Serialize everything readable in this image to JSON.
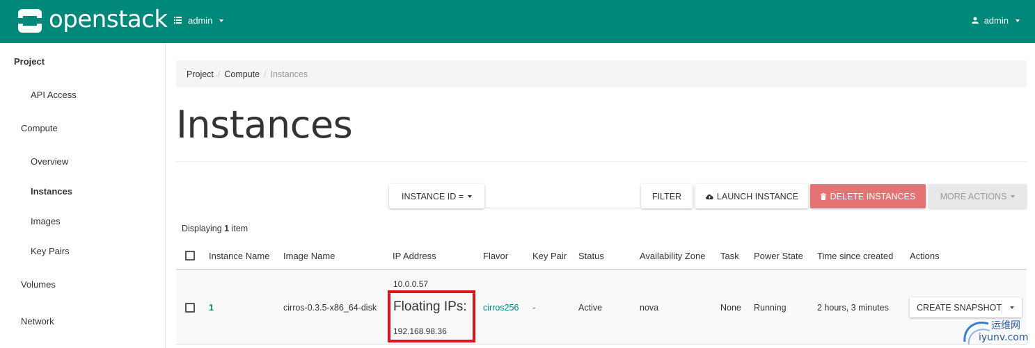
{
  "header": {
    "brand": "openstack",
    "project_label": "admin",
    "user_label": "admin",
    "color": "#00897b"
  },
  "sidebar": {
    "items": [
      {
        "label": "Project",
        "level": 0,
        "bold": true
      },
      {
        "label": "API Access",
        "level": 2
      },
      {
        "label": "Compute",
        "level": 1
      },
      {
        "label": "Overview",
        "level": 2
      },
      {
        "label": "Instances",
        "level": 2,
        "active": true
      },
      {
        "label": "Images",
        "level": 2
      },
      {
        "label": "Key Pairs",
        "level": 2
      },
      {
        "label": "Volumes",
        "level": 1
      },
      {
        "label": "Network",
        "level": 1
      }
    ]
  },
  "breadcrumb": {
    "items": [
      "Project",
      "Compute",
      "Instances"
    ],
    "separator": "/"
  },
  "page": {
    "title": "Instances"
  },
  "toolbar": {
    "filter_field": "INSTANCE ID =",
    "filter_button": "FILTER",
    "launch_button": "LAUNCH INSTANCE",
    "delete_button": "DELETE INSTANCES",
    "more_actions": "MORE ACTIONS",
    "danger_color": "#e57373"
  },
  "table": {
    "display_prefix": "Displaying",
    "display_count": "1",
    "display_suffix": "item",
    "columns": [
      "Instance Name",
      "Image Name",
      "IP Address",
      "Flavor",
      "Key Pair",
      "Status",
      "Availability Zone",
      "Task",
      "Power State",
      "Time since created",
      "Actions"
    ],
    "rows": [
      {
        "instance_name": "1",
        "image_name": "cirros-0.3.5-x86_64-disk",
        "ip_address": "10.0.0.57",
        "floating_label": "Floating IPs:",
        "floating_ip": "192.168.98.36",
        "flavor": "cirros256",
        "key_pair": "-",
        "status": "Active",
        "availability_zone": "nova",
        "task": "None",
        "power_state": "Running",
        "time_since_created": "2 hours, 3 minutes",
        "action": "CREATE SNAPSHOT"
      }
    ]
  },
  "annotation": {
    "highlight_color": "#e0141e"
  },
  "watermark": {
    "line1": "运维网",
    "line2": "iyunv.com"
  }
}
